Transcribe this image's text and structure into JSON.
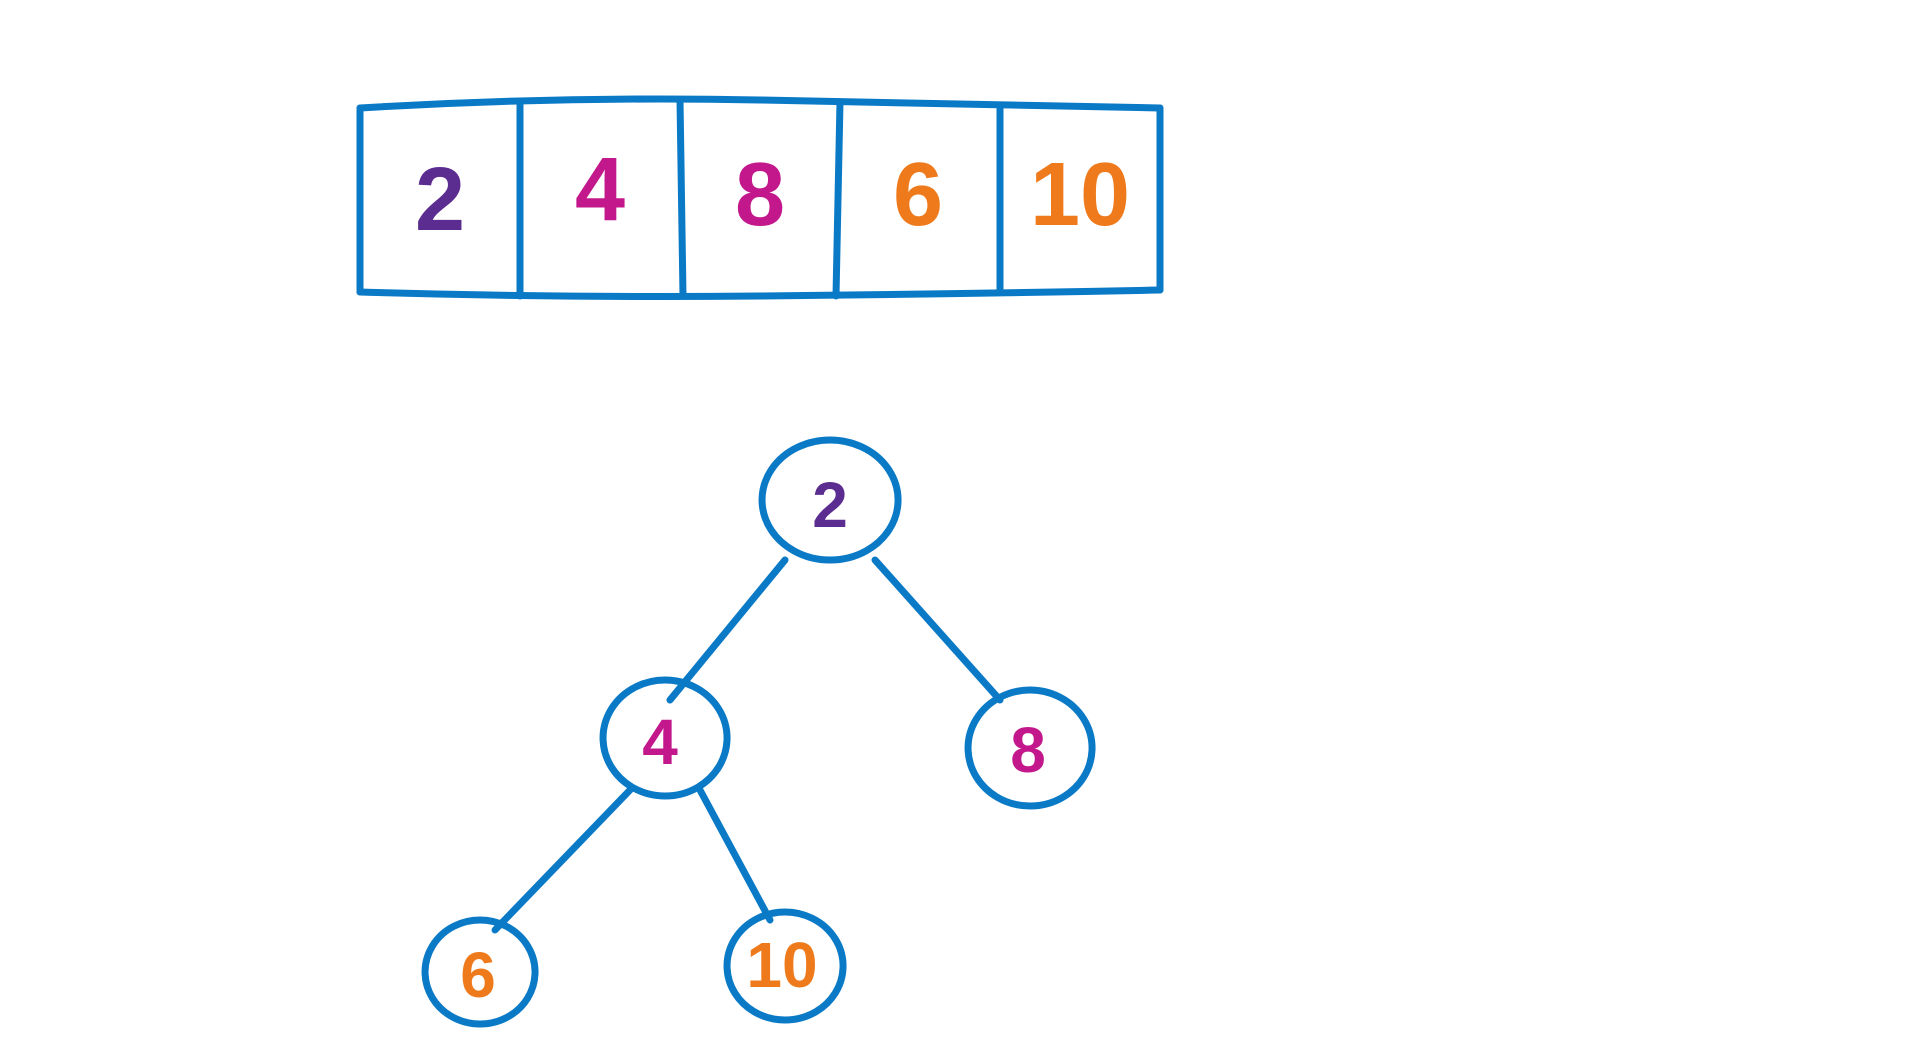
{
  "array": {
    "cells": [
      "2",
      "4",
      "8",
      "6",
      "10"
    ],
    "colors": [
      "purple",
      "magenta",
      "magenta",
      "orange",
      "orange"
    ]
  },
  "tree": {
    "root": {
      "value": "2",
      "color": "purple"
    },
    "left": {
      "value": "4",
      "color": "magenta"
    },
    "right": {
      "value": "8",
      "color": "magenta"
    },
    "left_left": {
      "value": "6",
      "color": "orange"
    },
    "left_right": {
      "value": "10",
      "color": "orange"
    }
  },
  "style": {
    "stroke": "#0a7ac7",
    "stroke_width": "7"
  }
}
